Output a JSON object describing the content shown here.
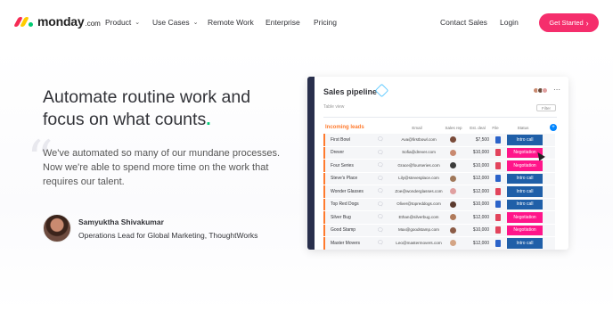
{
  "brand": {
    "name": "monday",
    "suffix": ".com"
  },
  "nav": {
    "items": [
      {
        "label": "Product",
        "dropdown": true
      },
      {
        "label": "Use Cases",
        "dropdown": true
      },
      {
        "label": "Remote Work",
        "dropdown": false
      },
      {
        "label": "Enterprise",
        "dropdown": false
      },
      {
        "label": "Pricing",
        "dropdown": false
      }
    ],
    "contact_sales": "Contact Sales",
    "login": "Login",
    "cta": "Get Started",
    "cta_arrow": "›"
  },
  "hero": {
    "headline": "Automate routine work and focus on what counts",
    "headline_period": ".",
    "quote": "We've automated so many of our mundane processes. Now we're able to spend more time on the work that requires our talent.",
    "author_name": "Samyuktha Shivakumar",
    "author_role": "Operations Lead for Global Marketing, ThoughtWorks"
  },
  "board": {
    "title": "Sales pipeline",
    "view_label": "Table view",
    "filter_label": "Filter",
    "group_title": "Incoming leads",
    "columns": [
      "Email",
      "Sales rep",
      "Est. deal",
      "File",
      "Status"
    ],
    "rows": [
      {
        "name": "First Bowl",
        "email": "Ava@firstbowl.com",
        "amount": "$7,500",
        "file": "doc",
        "status": "Intro call"
      },
      {
        "name": "Drever",
        "email": "Sofia@drever.com",
        "amount": "$10,000",
        "file": "pdf",
        "status": "Negotiation"
      },
      {
        "name": "Four Series",
        "email": "Grace@fourseries.com",
        "amount": "$10,000",
        "file": "pdf",
        "status": "Negotiation"
      },
      {
        "name": "Steve's Place",
        "email": "Lily@stevesplace.com",
        "amount": "$12,000",
        "file": "doc",
        "status": "Intro call"
      },
      {
        "name": "Wonder Glasses",
        "email": "Zoe@wonderglasses.com",
        "amount": "$12,000",
        "file": "pdf",
        "status": "Intro call"
      },
      {
        "name": "Top Red Dogs",
        "email": "Oliver@topreddogs.com",
        "amount": "$10,000",
        "file": "doc",
        "status": "Intro call"
      },
      {
        "name": "Silver Bug",
        "email": "Ethan@silverbug.com",
        "amount": "$12,000",
        "file": "pdf",
        "status": "Negotiation"
      },
      {
        "name": "Good Stamp",
        "email": "Max@goodstamp.com",
        "amount": "$10,000",
        "file": "pdf",
        "status": "Negotiation"
      },
      {
        "name": "Master Movers",
        "email": "Leo@mastermovers.com",
        "amount": "$12,000",
        "file": "doc",
        "status": "Intro call"
      }
    ]
  },
  "colors": {
    "accent": "#f52e6c",
    "intro_call": "#1f5fa8",
    "negotiation": "#ff158a",
    "group": "#ff7b2e",
    "period": "#00c875"
  },
  "icons": {
    "chevron": "chevron-down-icon",
    "chat": "chat-bubble-icon",
    "add": "plus-icon"
  }
}
